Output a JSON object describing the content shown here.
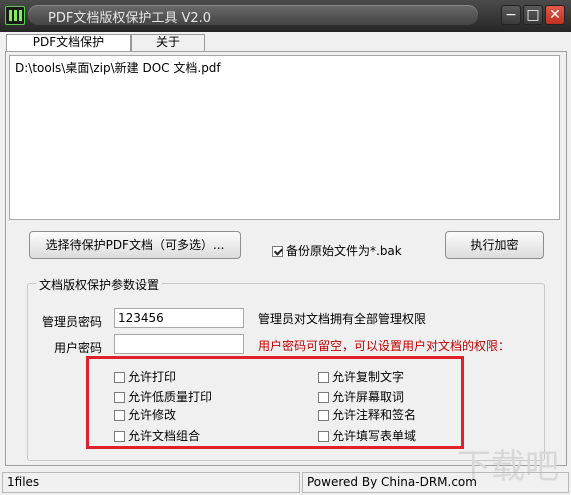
{
  "window": {
    "title": "PDF文档版权保护工具 V2.0",
    "controls": {
      "minimize": "−",
      "maximize": "□",
      "close": "✕"
    }
  },
  "tabs": [
    {
      "label": "PDF文档保护",
      "active": true
    },
    {
      "label": "关于",
      "active": false
    }
  ],
  "file_list": {
    "items": [
      "D:\\tools\\桌面\\zip\\新建 DOC 文档.pdf"
    ]
  },
  "actions": {
    "select_files_label": "选择待保护PDF文档（可多选）...",
    "backup_label": "备份原始文件为*.bak",
    "backup_checked": true,
    "encrypt_label": "执行加密"
  },
  "settings": {
    "group_title": "文档版权保护参数设置",
    "admin_password_label": "管理员密码",
    "admin_password_value": "123456",
    "admin_note": "管理员对文档拥有全部管理权限",
    "user_password_label": "用户密码",
    "user_password_value": "",
    "user_note": "用户密码可留空，可以设置用户对文档的权限：",
    "user_note_color": "#c00000"
  },
  "permissions": {
    "left": [
      {
        "label": "允许打印",
        "checked": false
      },
      {
        "label": "允许低质量打印",
        "checked": false
      },
      {
        "label": "允许修改",
        "checked": false
      },
      {
        "label": "允许文档组合",
        "checked": false
      }
    ],
    "right": [
      {
        "label": "允许复制文字",
        "checked": false
      },
      {
        "label": "允许屏幕取词",
        "checked": false
      },
      {
        "label": "允许注释和签名",
        "checked": false
      },
      {
        "label": "允许填写表单域",
        "checked": false
      }
    ],
    "highlight_color": "#e0202a"
  },
  "status_bar": {
    "files": "1files",
    "powered_by": "Powered By China-DRM.com"
  },
  "watermark": {
    "text": "下载吧"
  }
}
